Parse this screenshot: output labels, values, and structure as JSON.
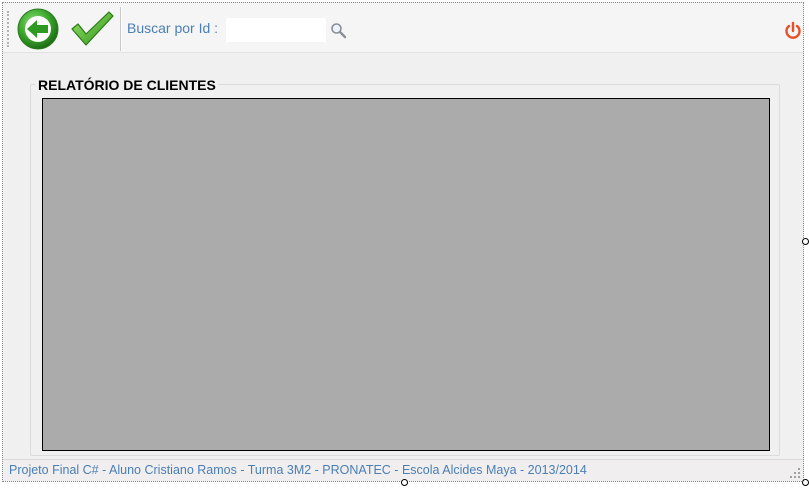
{
  "toolbar": {
    "back_icon": "back-arrow-icon",
    "confirm_icon": "checkmark-icon",
    "search_label": "Buscar por Id :",
    "search_value": "",
    "search_icon": "magnifier-icon",
    "power_icon": "power-icon",
    "colors": {
      "label": "#4a7fb5",
      "back_green": "#3aa52a",
      "power_red": "#e8502a"
    }
  },
  "report": {
    "title": "RELATÓRIO DE CLIENTES",
    "viewer_background": "#ababab"
  },
  "status": {
    "text": "Projeto Final C# - Aluno Cristiano Ramos - Turma  3M2 - PRONATEC - Escola Alcides Maya - 2013/2014"
  }
}
